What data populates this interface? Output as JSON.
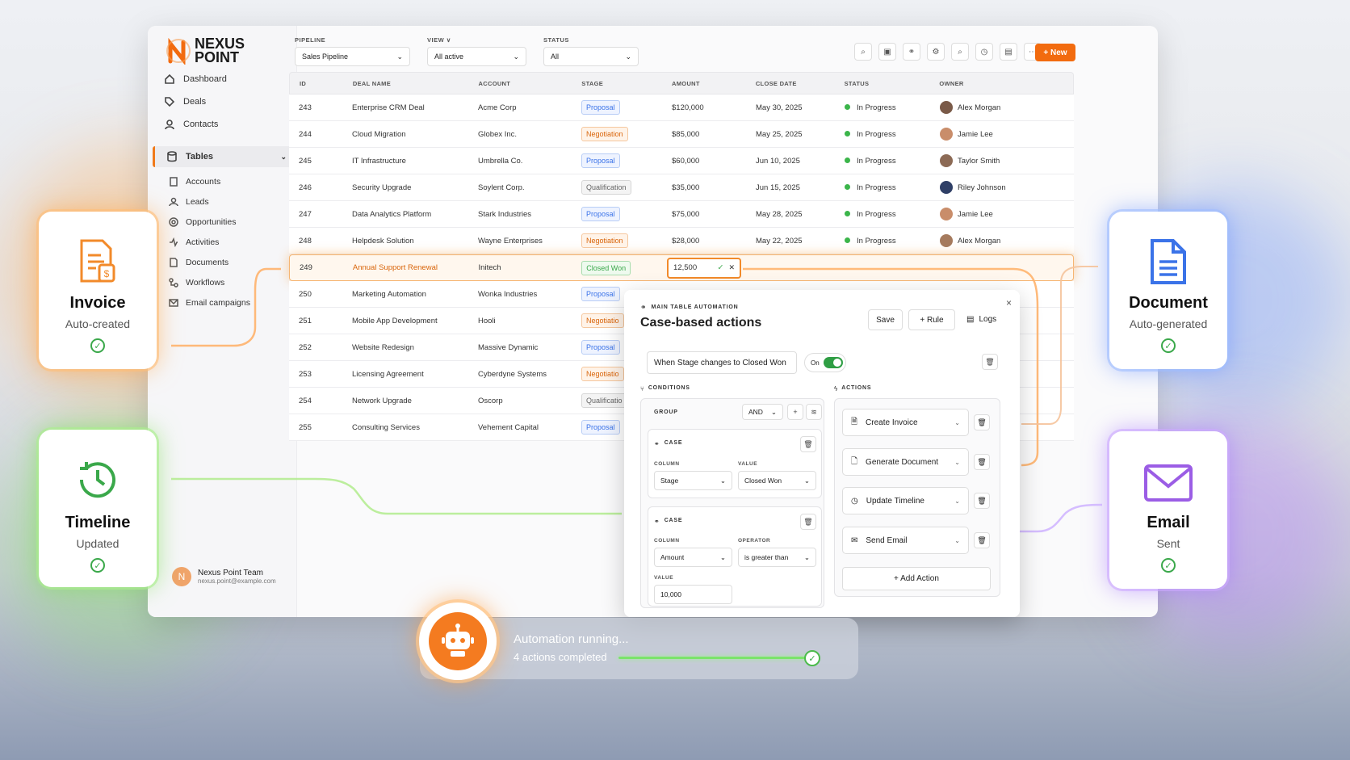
{
  "brand": {
    "line1": "NEXUS",
    "line2": "POINT",
    "accent": "#f26b0f"
  },
  "sidebar": {
    "main": [
      {
        "label": "Dashboard",
        "icon": "home-icon"
      },
      {
        "label": "Deals",
        "icon": "tag-icon"
      },
      {
        "label": "Contacts",
        "icon": "person-icon"
      }
    ],
    "tables_label": "Tables",
    "tables": [
      {
        "label": "Accounts"
      },
      {
        "label": "Leads"
      },
      {
        "label": "Opportunities"
      },
      {
        "label": "Activities"
      },
      {
        "label": "Documents"
      },
      {
        "label": "Workflows"
      },
      {
        "label": "Email campaigns"
      }
    ],
    "user": {
      "initial": "N",
      "name": "Nexus Point Team",
      "email": "nexus.point@example.com"
    }
  },
  "filters": [
    {
      "label": "PIPELINE",
      "value": "Sales Pipeline"
    },
    {
      "label": "VIEW ∨",
      "value": "All active"
    },
    {
      "label": "STATUS",
      "value": "All"
    }
  ],
  "new_button": "+ New",
  "table": {
    "headers": [
      "ID",
      "DEAL NAME",
      "ACCOUNT",
      "STAGE",
      "AMOUNT",
      "CLOSE DATE",
      "STATUS",
      "OWNER"
    ],
    "rows": [
      {
        "id": "243",
        "name": "Enterprise CRM Deal",
        "account": "Acme Corp",
        "stage": "Proposal",
        "amount": "$120,000",
        "close": "May 30, 2025",
        "status": "In Progress",
        "owner": "Alex Morgan"
      },
      {
        "id": "244",
        "name": "Cloud Migration",
        "account": "Globex Inc.",
        "stage": "Negotiation",
        "amount": "$85,000",
        "close": "May 25, 2025",
        "status": "In Progress",
        "owner": "Jamie Lee"
      },
      {
        "id": "245",
        "name": "IT Infrastructure",
        "account": "Umbrella Co.",
        "stage": "Proposal",
        "amount": "$60,000",
        "close": "Jun 10, 2025",
        "status": "In Progress",
        "owner": "Taylor Smith"
      },
      {
        "id": "246",
        "name": "Security Upgrade",
        "account": "Soylent Corp.",
        "stage": "Qualification",
        "amount": "$35,000",
        "close": "Jun 15, 2025",
        "status": "In Progress",
        "owner": "Riley Johnson"
      },
      {
        "id": "247",
        "name": "Data Analytics Platform",
        "account": "Stark Industries",
        "stage": "Proposal",
        "amount": "$75,000",
        "close": "May 28, 2025",
        "status": "In Progress",
        "owner": "Jamie Lee"
      },
      {
        "id": "248",
        "name": "Helpdesk Solution",
        "account": "Wayne Enterprises",
        "stage": "Negotiation",
        "amount": "$28,000",
        "close": "May 22, 2025",
        "status": "In Progress",
        "owner": "Alex Morgan"
      },
      {
        "id": "249",
        "name": "Annual Support Renewal",
        "account": "Initech",
        "stage": "Closed Won",
        "amount": "12,500",
        "close": "",
        "status": "",
        "owner": ""
      },
      {
        "id": "250",
        "name": "Marketing Automation",
        "account": "Wonka Industries",
        "stage": "Proposal"
      },
      {
        "id": "251",
        "name": "Mobile App Development",
        "account": "Hooli",
        "stage": "Negotiatio"
      },
      {
        "id": "252",
        "name": "Website Redesign",
        "account": "Massive Dynamic",
        "stage": "Proposal"
      },
      {
        "id": "253",
        "name": "Licensing Agreement",
        "account": "Cyberdyne Systems",
        "stage": "Negotiatio"
      },
      {
        "id": "254",
        "name": "Network Upgrade",
        "account": "Oscorp",
        "stage": "Qualificatio"
      },
      {
        "id": "255",
        "name": "Consulting Services",
        "account": "Vehement Capital",
        "stage": "Proposal"
      }
    ]
  },
  "cards": {
    "invoice": {
      "title": "Invoice",
      "sub": "Auto-created"
    },
    "document": {
      "title": "Document",
      "sub": "Auto-generated"
    },
    "timeline": {
      "title": "Timeline",
      "sub": "Updated"
    },
    "email": {
      "title": "Email",
      "sub": "Sent"
    }
  },
  "panel": {
    "eyebrow": "MAIN TABLE AUTOMATION",
    "title": "Case-based actions",
    "save": "Save",
    "rule": "+ Rule",
    "logs": "Logs",
    "trigger": "When Stage changes to Closed Won",
    "toggle": "On",
    "conditions": "CONDITIONS",
    "actions_label": "ACTIONS",
    "group": "GROUP",
    "group_op": "AND",
    "case1": {
      "label": "CASE",
      "col_lbl": "COLUMN",
      "col": "Stage",
      "val_lbl": "VALUE",
      "val": "Closed Won"
    },
    "case2": {
      "label": "CASE",
      "col_lbl": "COLUMN",
      "col": "Amount",
      "op_lbl": "OPERATOR",
      "op": "is greater than",
      "val_lbl": "VALUE",
      "val": "10,000"
    },
    "actions": [
      {
        "label": "Create Invoice"
      },
      {
        "label": "Generate Document"
      },
      {
        "label": "Update Timeline"
      },
      {
        "label": "Send Email"
      }
    ],
    "add_action": "+ Add Action"
  },
  "run": {
    "title": "Automation running...",
    "sub": "4 actions completed",
    "progress": 1.0
  }
}
